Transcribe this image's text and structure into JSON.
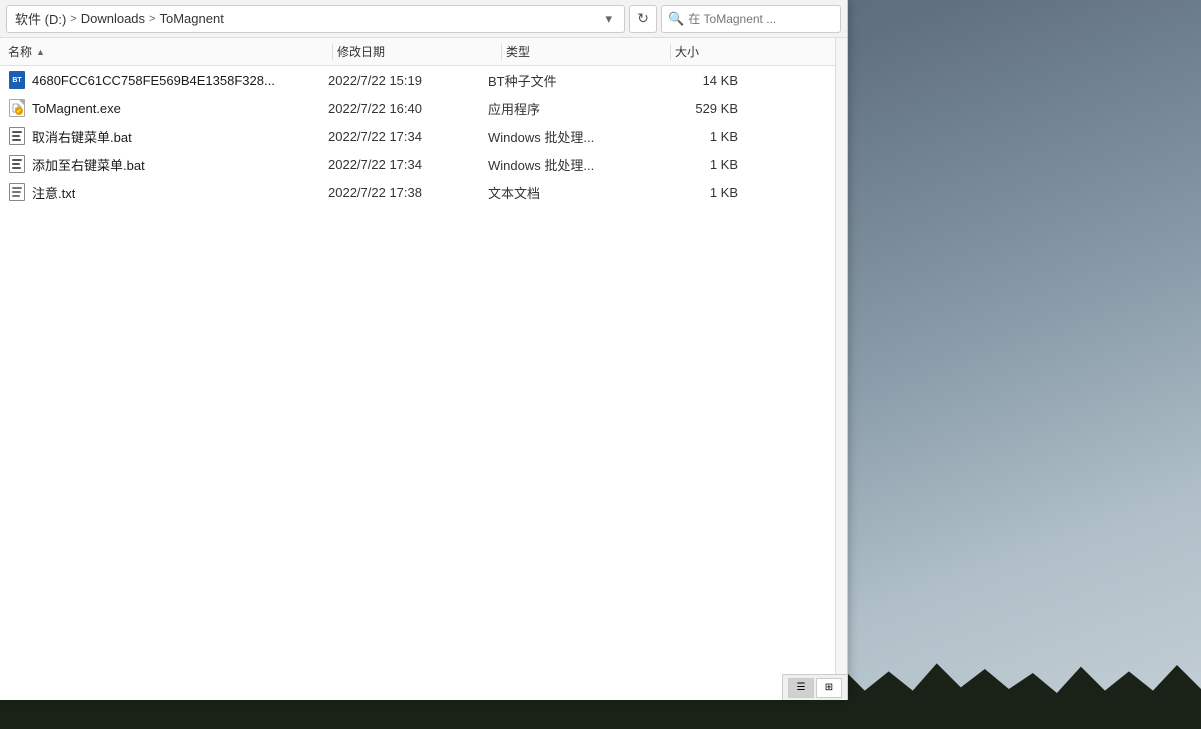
{
  "desktop": {
    "background_colors": [
      "#4a6070",
      "#8a9daa",
      "#c5cfd6"
    ]
  },
  "explorer": {
    "breadcrumb": {
      "drive": "软件 (D:)",
      "separator1": ">",
      "folder": "Downloads",
      "separator2": ">",
      "subfolder": "ToMagnent"
    },
    "search_placeholder": "在 ToMagnent ...",
    "columns": {
      "name": "名称",
      "date": "修改日期",
      "type": "类型",
      "size": "大小"
    },
    "files": [
      {
        "name": "4680FCC61CC758FE569B4E1358F328...",
        "date": "2022/7/22 15:19",
        "type": "BT种子文件",
        "size": "14 KB",
        "icon": "torrent"
      },
      {
        "name": "ToMagnent.exe",
        "date": "2022/7/22 16:40",
        "type": "应用程序",
        "size": "529 KB",
        "icon": "exe"
      },
      {
        "name": "取消右键菜单.bat",
        "date": "2022/7/22 17:34",
        "type": "Windows 批处理...",
        "size": "1 KB",
        "icon": "bat"
      },
      {
        "name": "添加至右键菜单.bat",
        "date": "2022/7/22 17:34",
        "type": "Windows 批处理...",
        "size": "1 KB",
        "icon": "bat"
      },
      {
        "name": "注意.txt",
        "date": "2022/7/22 17:38",
        "type": "文本文档",
        "size": "1 KB",
        "icon": "txt"
      }
    ]
  },
  "taskbar": {
    "view_list_label": "列表视图",
    "view_detail_label": "详情视图"
  }
}
